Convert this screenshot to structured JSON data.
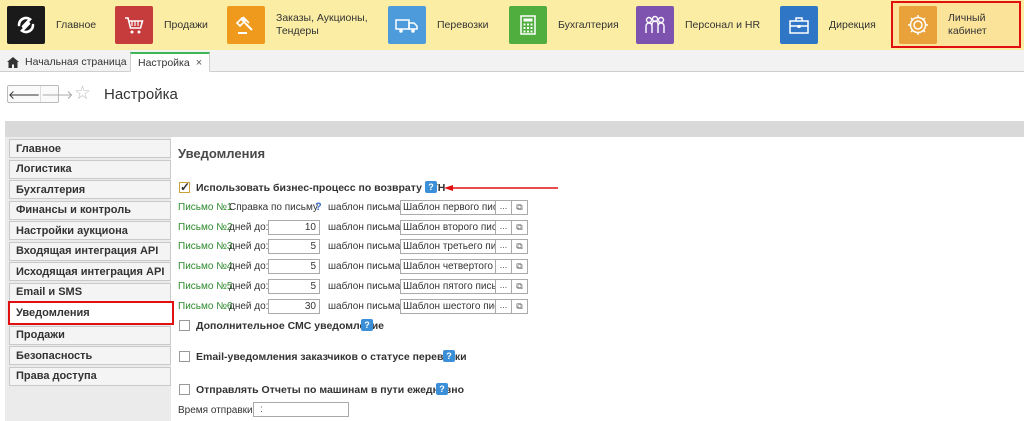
{
  "sections": [
    {
      "label": "Главное",
      "icon": "logo-icon",
      "color": "#1a1a1a"
    },
    {
      "label": "Продажи",
      "icon": "cart-icon",
      "color": "#c63b3b"
    },
    {
      "label": "Заказы,  Аукционы,\nТендеры",
      "icon": "gavel-icon",
      "color": "#ef9a1c"
    },
    {
      "label": "Перевозки",
      "icon": "truck-icon",
      "color": "#4d9bdb"
    },
    {
      "label": "Бухгалтерия",
      "icon": "calculator-icon",
      "color": "#4fae3e"
    },
    {
      "label": "Персонал и HR",
      "icon": "people-icon",
      "color": "#7e53b0"
    },
    {
      "label": "Дирекция",
      "icon": "briefcase-icon",
      "color": "#2f77c6"
    },
    {
      "label": "Личный кабинет",
      "icon": "gear-icon",
      "color": "#e9a13a"
    }
  ],
  "tabs": {
    "home": "Начальная страница",
    "active": "Настройка",
    "close": "×"
  },
  "page": {
    "title": "Настройка",
    "back": "🡐",
    "forward": "🡒",
    "star": "☆"
  },
  "sidebar": {
    "items": [
      "Главное",
      "Логистика",
      "Бухгалтерия",
      "Финансы и контроль",
      "Настройки аукциона",
      "Входящая интеграция API",
      "Исходящая интеграция API",
      "Email и SMS",
      "Уведомления",
      "Продажи",
      "Безопасность",
      "Права доступа"
    ],
    "active_index": 8
  },
  "main": {
    "title": "Уведомления",
    "use_process": {
      "label": "Использовать бизнес-процесс по возврату ТТН",
      "checked": true
    },
    "help": "?",
    "letters": [
      {
        "num": "Письмо №1",
        "sub": "Справка по письму",
        "q": "?",
        "days": null,
        "tpl_label": "шаблон письма:",
        "tpl": "Шаблон первого письма"
      },
      {
        "num": "Письмо №2",
        "sub": "дней до:",
        "days": "10",
        "tpl_label": "шаблон письма:",
        "tpl": "Шаблон второго письма"
      },
      {
        "num": "Письмо №3",
        "sub": "дней до:",
        "days": "5",
        "tpl_label": "шаблон письма:",
        "tpl": "Шаблон третьего письма"
      },
      {
        "num": "Письмо №4",
        "sub": "дней до:",
        "days": "5",
        "tpl_label": "шаблон письма:",
        "tpl": "Шаблон четвертого письма"
      },
      {
        "num": "Письмо №5",
        "sub": "дней до:",
        "days": "5",
        "tpl_label": "шаблон письма:",
        "tpl": "Шаблон пятого письма"
      },
      {
        "num": "Письмо №6",
        "sub": "дней до:",
        "days": "30",
        "tpl_label": "шаблон письма:",
        "tpl": "Шаблон шестого письма"
      }
    ],
    "dots": "...",
    "open": "⧉",
    "sms": {
      "label": "Дополнительное СМС уведомление",
      "checked": false
    },
    "email_status": {
      "label": "Email-уведомления заказчиков о статусе перевозки",
      "checked": false
    },
    "reports": {
      "label": "Отправлять Отчеты по машинам в пути ежедневно",
      "checked": false
    },
    "send_time_label": "Время отправки:",
    "send_time_value": ":"
  }
}
